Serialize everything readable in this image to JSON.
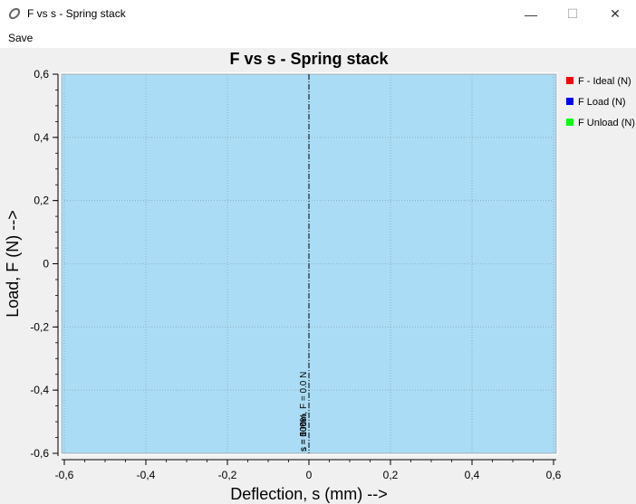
{
  "window": {
    "title": "F vs s - Spring stack",
    "minimize_glyph": "—",
    "maximize_glyph": "☐",
    "close_glyph": "✕"
  },
  "menu": {
    "save_label": "Save"
  },
  "colors": {
    "plot_bg": "#aadcf5",
    "grid": "#8aa8b8",
    "ideal": "#ff0000",
    "load": "#0000ff",
    "unload": "#00ff00"
  },
  "chart_data": {
    "type": "line",
    "title": "F vs s - Spring stack",
    "xlabel": "Deflection, s (mm) -->",
    "ylabel": "Load, F (N) -->",
    "xlim": [
      -0.6,
      0.6
    ],
    "ylim": [
      -0.6,
      0.6
    ],
    "x_ticks": [
      -0.6,
      -0.4,
      -0.2,
      0,
      0.2,
      0.4,
      0.6
    ],
    "y_ticks": [
      -0.6,
      -0.4,
      -0.2,
      0,
      0.2,
      0.4,
      0.6
    ],
    "x_tick_labels": [
      "-0,6",
      "-0,4",
      "-0,2",
      "0",
      "0,2",
      "0,4",
      "0,6"
    ],
    "y_tick_labels": [
      "-0,6",
      "-0,4",
      "-0,2",
      "0",
      "0,2",
      "0,4",
      "0,6"
    ],
    "grid": true,
    "legend_position": "right",
    "series": [
      {
        "name": "F - Ideal (N)",
        "values": []
      },
      {
        "name": "F Load (N)",
        "values": []
      },
      {
        "name": "F Unload (N)",
        "values": []
      }
    ],
    "vertical_marker": {
      "x": 0
    },
    "annotations": [
      "s = 0 mm,  F = 0.0 N",
      "s = 50%",
      "s = 100%"
    ]
  }
}
